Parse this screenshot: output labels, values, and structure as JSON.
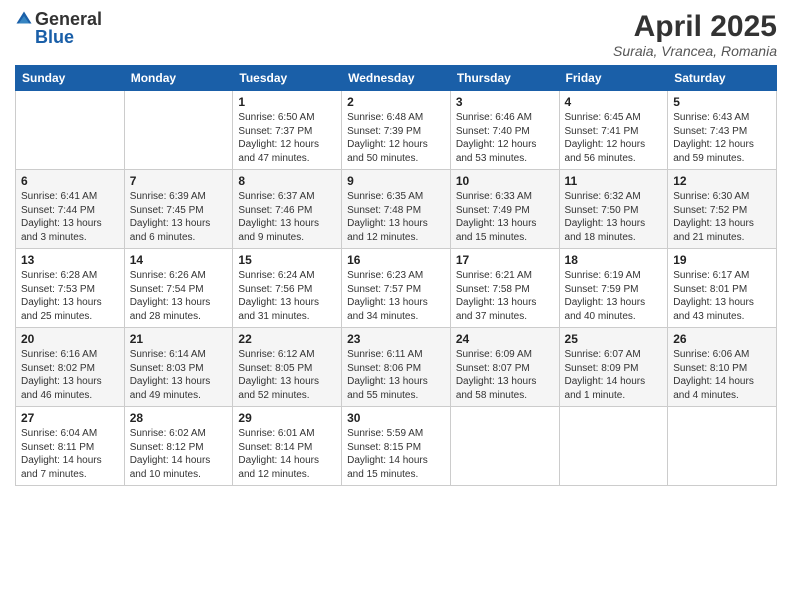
{
  "logo": {
    "general": "General",
    "blue": "Blue"
  },
  "title": {
    "month": "April 2025",
    "location": "Suraia, Vrancea, Romania"
  },
  "weekdays": [
    "Sunday",
    "Monday",
    "Tuesday",
    "Wednesday",
    "Thursday",
    "Friday",
    "Saturday"
  ],
  "weeks": [
    [
      {
        "day": "",
        "info": ""
      },
      {
        "day": "",
        "info": ""
      },
      {
        "day": "1",
        "info": "Sunrise: 6:50 AM\nSunset: 7:37 PM\nDaylight: 12 hours and 47 minutes."
      },
      {
        "day": "2",
        "info": "Sunrise: 6:48 AM\nSunset: 7:39 PM\nDaylight: 12 hours and 50 minutes."
      },
      {
        "day": "3",
        "info": "Sunrise: 6:46 AM\nSunset: 7:40 PM\nDaylight: 12 hours and 53 minutes."
      },
      {
        "day": "4",
        "info": "Sunrise: 6:45 AM\nSunset: 7:41 PM\nDaylight: 12 hours and 56 minutes."
      },
      {
        "day": "5",
        "info": "Sunrise: 6:43 AM\nSunset: 7:43 PM\nDaylight: 12 hours and 59 minutes."
      }
    ],
    [
      {
        "day": "6",
        "info": "Sunrise: 6:41 AM\nSunset: 7:44 PM\nDaylight: 13 hours and 3 minutes."
      },
      {
        "day": "7",
        "info": "Sunrise: 6:39 AM\nSunset: 7:45 PM\nDaylight: 13 hours and 6 minutes."
      },
      {
        "day": "8",
        "info": "Sunrise: 6:37 AM\nSunset: 7:46 PM\nDaylight: 13 hours and 9 minutes."
      },
      {
        "day": "9",
        "info": "Sunrise: 6:35 AM\nSunset: 7:48 PM\nDaylight: 13 hours and 12 minutes."
      },
      {
        "day": "10",
        "info": "Sunrise: 6:33 AM\nSunset: 7:49 PM\nDaylight: 13 hours and 15 minutes."
      },
      {
        "day": "11",
        "info": "Sunrise: 6:32 AM\nSunset: 7:50 PM\nDaylight: 13 hours and 18 minutes."
      },
      {
        "day": "12",
        "info": "Sunrise: 6:30 AM\nSunset: 7:52 PM\nDaylight: 13 hours and 21 minutes."
      }
    ],
    [
      {
        "day": "13",
        "info": "Sunrise: 6:28 AM\nSunset: 7:53 PM\nDaylight: 13 hours and 25 minutes."
      },
      {
        "day": "14",
        "info": "Sunrise: 6:26 AM\nSunset: 7:54 PM\nDaylight: 13 hours and 28 minutes."
      },
      {
        "day": "15",
        "info": "Sunrise: 6:24 AM\nSunset: 7:56 PM\nDaylight: 13 hours and 31 minutes."
      },
      {
        "day": "16",
        "info": "Sunrise: 6:23 AM\nSunset: 7:57 PM\nDaylight: 13 hours and 34 minutes."
      },
      {
        "day": "17",
        "info": "Sunrise: 6:21 AM\nSunset: 7:58 PM\nDaylight: 13 hours and 37 minutes."
      },
      {
        "day": "18",
        "info": "Sunrise: 6:19 AM\nSunset: 7:59 PM\nDaylight: 13 hours and 40 minutes."
      },
      {
        "day": "19",
        "info": "Sunrise: 6:17 AM\nSunset: 8:01 PM\nDaylight: 13 hours and 43 minutes."
      }
    ],
    [
      {
        "day": "20",
        "info": "Sunrise: 6:16 AM\nSunset: 8:02 PM\nDaylight: 13 hours and 46 minutes."
      },
      {
        "day": "21",
        "info": "Sunrise: 6:14 AM\nSunset: 8:03 PM\nDaylight: 13 hours and 49 minutes."
      },
      {
        "day": "22",
        "info": "Sunrise: 6:12 AM\nSunset: 8:05 PM\nDaylight: 13 hours and 52 minutes."
      },
      {
        "day": "23",
        "info": "Sunrise: 6:11 AM\nSunset: 8:06 PM\nDaylight: 13 hours and 55 minutes."
      },
      {
        "day": "24",
        "info": "Sunrise: 6:09 AM\nSunset: 8:07 PM\nDaylight: 13 hours and 58 minutes."
      },
      {
        "day": "25",
        "info": "Sunrise: 6:07 AM\nSunset: 8:09 PM\nDaylight: 14 hours and 1 minute."
      },
      {
        "day": "26",
        "info": "Sunrise: 6:06 AM\nSunset: 8:10 PM\nDaylight: 14 hours and 4 minutes."
      }
    ],
    [
      {
        "day": "27",
        "info": "Sunrise: 6:04 AM\nSunset: 8:11 PM\nDaylight: 14 hours and 7 minutes."
      },
      {
        "day": "28",
        "info": "Sunrise: 6:02 AM\nSunset: 8:12 PM\nDaylight: 14 hours and 10 minutes."
      },
      {
        "day": "29",
        "info": "Sunrise: 6:01 AM\nSunset: 8:14 PM\nDaylight: 14 hours and 12 minutes."
      },
      {
        "day": "30",
        "info": "Sunrise: 5:59 AM\nSunset: 8:15 PM\nDaylight: 14 hours and 15 minutes."
      },
      {
        "day": "",
        "info": ""
      },
      {
        "day": "",
        "info": ""
      },
      {
        "day": "",
        "info": ""
      }
    ]
  ]
}
